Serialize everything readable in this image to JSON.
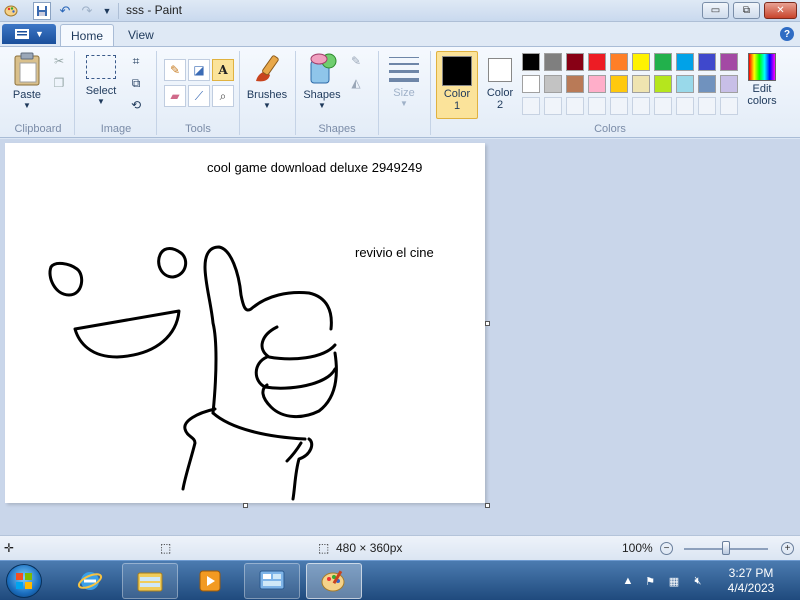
{
  "window": {
    "title": "sss - Paint",
    "minimize": "▭",
    "maximize": "⧉",
    "close": "✕"
  },
  "quick_access": {
    "save_icon": "save-icon",
    "undo_icon": "undo-icon",
    "redo_icon": "redo-icon",
    "customize_icon": "dropdown-icon"
  },
  "tabs": [
    {
      "label": "Home",
      "active": true
    },
    {
      "label": "View",
      "active": false
    }
  ],
  "help_label": "?",
  "ribbon": {
    "clipboard": {
      "label": "Clipboard",
      "paste": "Paste"
    },
    "image": {
      "label": "Image",
      "select": "Select"
    },
    "tools": {
      "label": "Tools"
    },
    "brushes": {
      "label": "Brushes"
    },
    "shapes": {
      "group_label": "Shapes",
      "button": "Shapes"
    },
    "size": {
      "label": "Size"
    },
    "colors": {
      "label": "Colors",
      "color1": "Color\n1",
      "color1_line1": "Color",
      "color1_line2": "1",
      "color2_line1": "Color",
      "color2_line2": "2",
      "edit_line1": "Edit",
      "edit_line2": "colors",
      "color1_value": "#000000",
      "color2_value": "#ffffff",
      "palette_row1": [
        "#000000",
        "#7f7f7f",
        "#880015",
        "#ed1c24",
        "#ff7f27",
        "#fff200",
        "#22b14c",
        "#00a2e8",
        "#3f48cc",
        "#a349a4"
      ],
      "palette_row2": [
        "#ffffff",
        "#c3c3c3",
        "#b97a57",
        "#ffaec9",
        "#ffc90e",
        "#efe4b0",
        "#b5e61d",
        "#99d9ea",
        "#7092be",
        "#c8bfe7"
      ]
    }
  },
  "canvas": {
    "text1": "cool game download deluxe 2949249",
    "text2": "revivio el cine"
  },
  "status": {
    "dimensions": "480 × 360px",
    "zoom": "100%",
    "zoom_fraction": 0.5
  },
  "taskbar": {
    "items": [
      "internet-explorer-icon",
      "file-explorer-icon",
      "media-player-icon",
      "control-panel-icon",
      "paint-icon"
    ],
    "time": "3:27 PM",
    "date": "4/4/2023"
  }
}
